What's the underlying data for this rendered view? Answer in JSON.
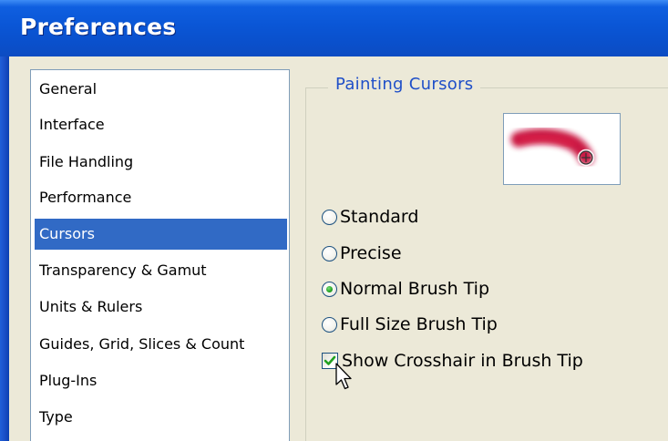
{
  "window": {
    "title": "Preferences"
  },
  "sidebar": {
    "items": [
      {
        "label": "General",
        "selected": false
      },
      {
        "label": "Interface",
        "selected": false
      },
      {
        "label": "File Handling",
        "selected": false
      },
      {
        "label": "Performance",
        "selected": false
      },
      {
        "label": "Cursors",
        "selected": true
      },
      {
        "label": "Transparency & Gamut",
        "selected": false
      },
      {
        "label": "Units & Rulers",
        "selected": false
      },
      {
        "label": "Guides, Grid, Slices & Count",
        "selected": false
      },
      {
        "label": "Plug-Ins",
        "selected": false
      },
      {
        "label": "Type",
        "selected": false
      }
    ]
  },
  "painting_cursors": {
    "group_label": "Painting Cursors",
    "options": [
      {
        "label": "Standard",
        "checked": false
      },
      {
        "label": "Precise",
        "checked": false
      },
      {
        "label": "Normal Brush Tip",
        "checked": true
      },
      {
        "label": "Full Size Brush Tip",
        "checked": false
      }
    ],
    "crosshair": {
      "label": "Show Crosshair in Brush Tip",
      "checked": true
    }
  },
  "colors": {
    "title_bar": "#0a56d6",
    "selection": "#316ac5",
    "group_label": "#1f4fc8",
    "brush_stroke": "#c8103a",
    "check_mark": "#21a121"
  },
  "icons": {
    "preview": "brush-stroke-preview",
    "cursor": "arrow-cursor-icon"
  }
}
